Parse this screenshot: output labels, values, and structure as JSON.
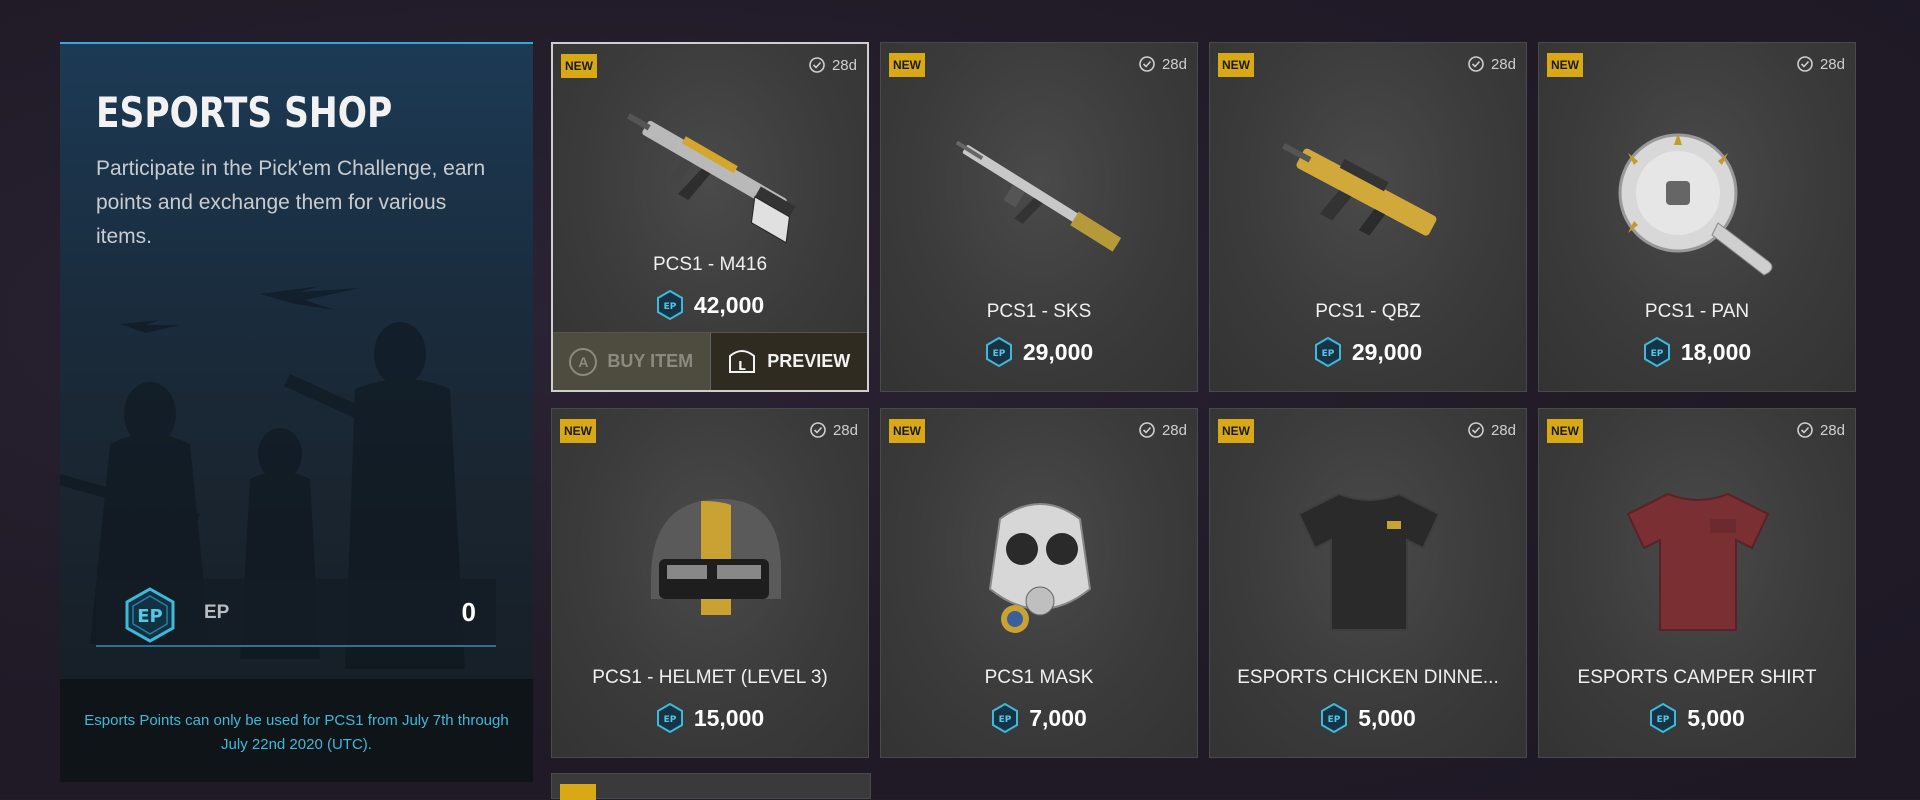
{
  "shop": {
    "title": "ESPORTS SHOP",
    "description": "Participate in the Pick'em Challenge, earn points and exchange them for various items.",
    "ep_label": "EP",
    "ep_value": "0",
    "ep_icon_text": "EP",
    "note": "Esports Points can only be used for PCS1 from July 7th through July 22nd 2020 (UTC)."
  },
  "colors": {
    "accent": "#3aa6d8",
    "new_badge": "#d8a915",
    "note_text": "#3fb9d8"
  },
  "items": [
    {
      "badge": "NEW",
      "duration": "28d",
      "name": "PCS1 - M416",
      "price": "42,000",
      "icon": "rifle-m416-icon"
    },
    {
      "badge": "NEW",
      "duration": "28d",
      "name": "PCS1 - SKS",
      "price": "29,000",
      "icon": "rifle-sks-icon"
    },
    {
      "badge": "NEW",
      "duration": "28d",
      "name": "PCS1 - QBZ",
      "price": "29,000",
      "icon": "rifle-qbz-icon"
    },
    {
      "badge": "NEW",
      "duration": "28d",
      "name": "PCS1 - PAN",
      "price": "18,000",
      "icon": "pan-icon"
    },
    {
      "badge": "NEW",
      "duration": "28d",
      "name": "PCS1 - HELMET (LEVEL 3)",
      "price": "15,000",
      "icon": "helmet-icon"
    },
    {
      "badge": "NEW",
      "duration": "28d",
      "name": "PCS1 MASK",
      "price": "7,000",
      "icon": "gas-mask-icon"
    },
    {
      "badge": "NEW",
      "duration": "28d",
      "name": "ESPORTS CHICKEN DINNE...",
      "price": "5,000",
      "icon": "black-shirt-icon"
    },
    {
      "badge": "NEW",
      "duration": "28d",
      "name": "ESPORTS CAMPER SHIRT",
      "price": "5,000",
      "icon": "red-shirt-icon"
    }
  ],
  "actions": {
    "buy_key": "A",
    "buy_label": "BUY ITEM",
    "preview_key": "L",
    "preview_label": "PREVIEW"
  },
  "currency_icon_text": "EP"
}
